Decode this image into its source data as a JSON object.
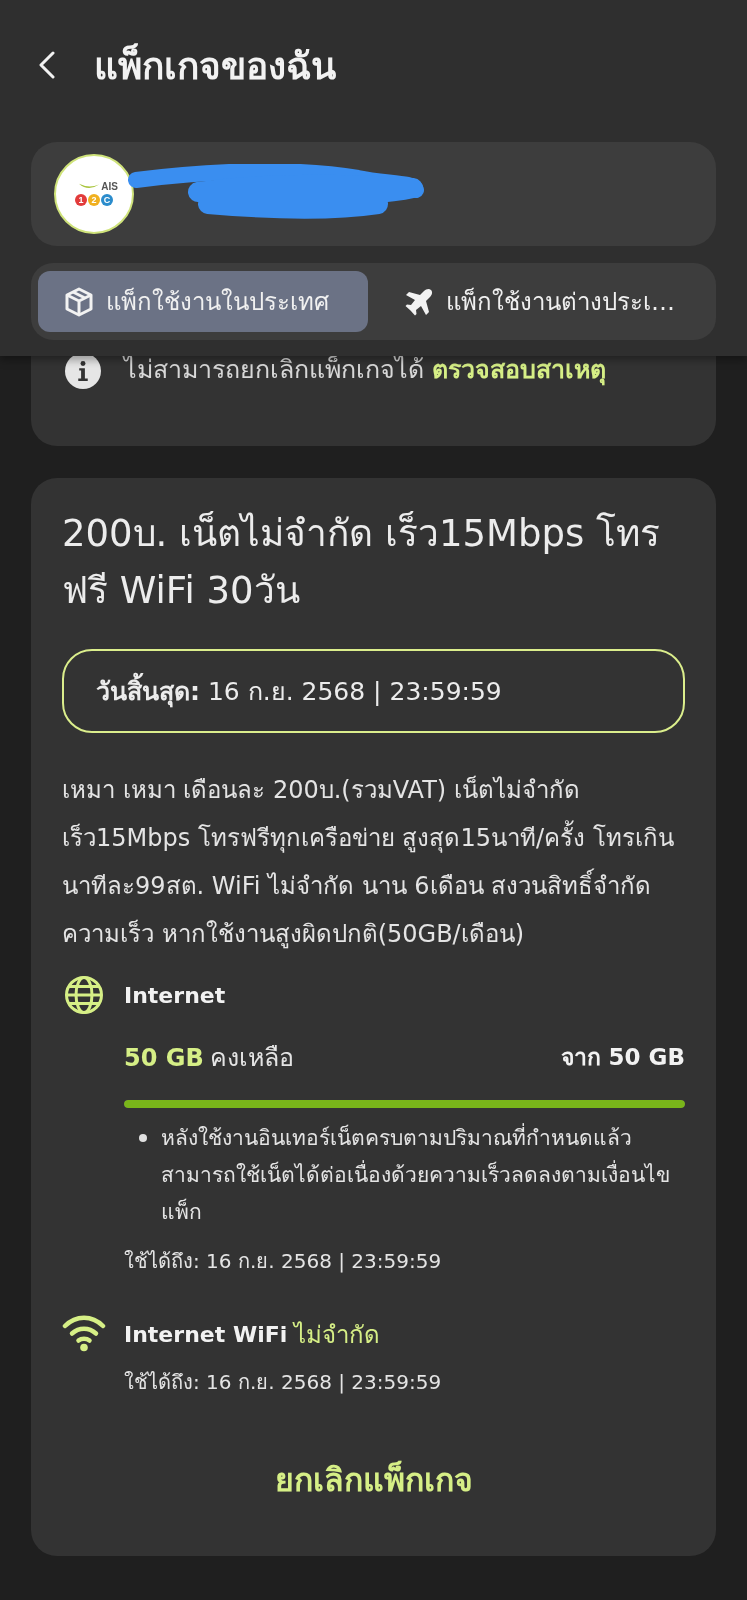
{
  "header": {
    "title": "แพ็กเกจของฉัน"
  },
  "account": {
    "logo": {
      "text": "AIS",
      "badges": [
        {
          "text": "1",
          "color": "#e23b3b"
        },
        {
          "text": "2",
          "color": "#f0b020"
        },
        {
          "text": "C",
          "color": "#2b8ccc"
        }
      ]
    },
    "name_hidden": true
  },
  "tabs": [
    {
      "kind": "domestic",
      "label": "แพ็กใช้งานในประเทศ",
      "selected": true
    },
    {
      "kind": "roaming",
      "label": "แพ็กใช้งานต่างประเ…",
      "selected": false
    }
  ],
  "notice": {
    "text": "ไม่สามารถยกเลิกแพ็กเกจได้",
    "link": "ตรวจสอบสาเหตุ"
  },
  "package": {
    "title": "200บ. เน็ตไม่จำกัด เร็ว15Mbps โทรฟรี WiFi 30วัน",
    "end_date": "**วันสิ้นสุด:** 16 ก.ย. 2568 | 23:59:59",
    "description": "เหมา เหมา เดือนละ 200บ.(รวมVAT) เน็ตไม่จำกัด เร็ว15Mbps โทรฟรีทุกเครือข่าย สูงสุด15นาที/ครั้ง โทรเกินนาทีละ99สต. WiFi ไม่จำกัด นาน 6เดือน สงวนสิทธิ์จำกัดความเร็ว หากใช้งานสูงผิดปกติ(50GB/เดือน)",
    "quotas": [
      {
        "kind": "data",
        "name": "Internet",
        "remaining": "50 GB",
        "remaining_label": "คงเหลือ",
        "total": "จาก 50 GB",
        "level": 1,
        "notes": [
          "หลังใช้งานอินเทอร์เน็ตครบตามปริมาณที่กำหนดแล้ว สามารถใช้เน็ตได้ต่อเนื่องด้วยความเร็วลดลงตามเงื่อนไขแพ็ก"
        ],
        "valid_until": "ใช้ได้ถึง: 16 ก.ย. 2568 | 23:59:59"
      },
      {
        "kind": "wifi",
        "name": "Internet WiFi",
        "amount": "ไม่จำกัด",
        "valid_until": "ใช้ได้ถึง: 16 ก.ย. 2568 | 23:59:59"
      }
    ],
    "cancel_button": "ยกเลิกแพ็กเกจ"
  }
}
